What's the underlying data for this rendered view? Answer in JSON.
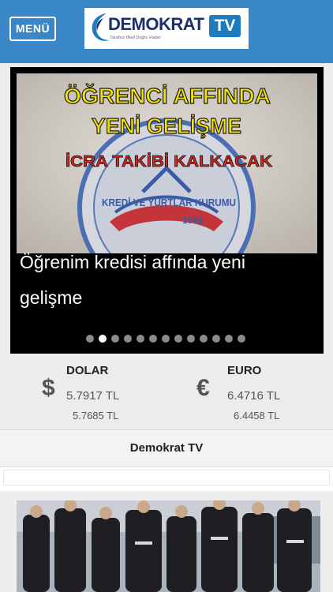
{
  "header": {
    "menu_label": "MENÜ",
    "logo": {
      "brand": "DEMOKRAT",
      "tv": "TV",
      "tagline": "Tarafsız İlkeli Doğru Haber"
    }
  },
  "slider": {
    "image_text": {
      "line1": "ÖĞRENCİ AFFINDA",
      "line2": "YENİ GELİŞME",
      "banner": "İCRA TAKİBİ KALKACAK",
      "seal_text": "KREDİ VE YURTLAR KURUMU",
      "seal_year": "1961"
    },
    "headline": "Öğrenim kredisi affında yeni gelişme",
    "dot_count": 13,
    "active_dot": 1
  },
  "currency": {
    "dollar": {
      "title": "DOLAR",
      "symbol": "$",
      "value1": "5.7917 TL",
      "value2": "5.7685 TL"
    },
    "euro": {
      "title": "EURO",
      "symbol": "€",
      "value1": "6.4716 TL",
      "value2": "6.4458 TL"
    }
  },
  "section": {
    "title": "Demokrat TV"
  },
  "colors": {
    "header_bg": "#3a87c8",
    "logo_navy": "#1c2f6c",
    "logo_blue": "#1c7cbf",
    "banner_red": "#d7261f",
    "headline_yellow": "#f5e400"
  }
}
